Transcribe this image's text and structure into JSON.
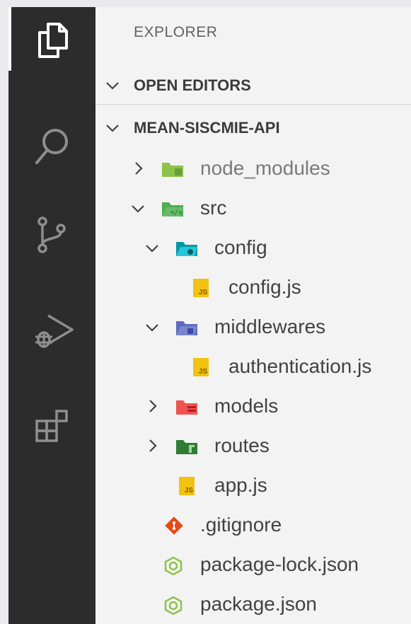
{
  "activity_bar": {
    "items": [
      {
        "icon": "files-icon",
        "active": true
      },
      {
        "icon": "search-icon",
        "active": false
      },
      {
        "icon": "source-control-icon",
        "active": false
      },
      {
        "icon": "run-debug-icon",
        "active": false
      },
      {
        "icon": "extensions-icon",
        "active": false
      }
    ]
  },
  "explorer": {
    "title": "EXPLORER",
    "open_editors_label": "OPEN EDITORS",
    "project_label": "MEAN-SISCMIE-API",
    "js_badge": "JS",
    "tree": [
      {
        "name": "node_modules",
        "type": "folder",
        "state": "collapsed",
        "icon": "node-folder-icon",
        "color": "#8bc34a"
      },
      {
        "name": "src",
        "type": "folder",
        "state": "expanded",
        "icon": "src-folder-icon",
        "color": "#4caf50"
      },
      {
        "name": "config",
        "type": "folder",
        "state": "expanded",
        "icon": "config-folder-icon",
        "color": "#26a6c5"
      },
      {
        "name": "config.js",
        "type": "file",
        "icon": "js-file-icon",
        "color": "#f3c10f"
      },
      {
        "name": "middlewares",
        "type": "folder",
        "state": "expanded",
        "icon": "middlewares-folder-icon",
        "color": "#7986cb"
      },
      {
        "name": "authentication.js",
        "type": "file",
        "icon": "js-file-icon",
        "color": "#f3c10f"
      },
      {
        "name": "models",
        "type": "folder",
        "state": "collapsed",
        "icon": "models-folder-icon",
        "color": "#ef5350"
      },
      {
        "name": "routes",
        "type": "folder",
        "state": "collapsed",
        "icon": "routes-folder-icon",
        "color": "#43a047"
      },
      {
        "name": "app.js",
        "type": "file",
        "icon": "js-file-icon",
        "color": "#f3c10f"
      },
      {
        "name": ".gitignore",
        "type": "file",
        "icon": "git-icon",
        "color": "#e64a19"
      },
      {
        "name": "package-lock.json",
        "type": "file",
        "icon": "nodejs-icon",
        "color": "#8bc34a"
      },
      {
        "name": "package.json",
        "type": "file",
        "icon": "nodejs-icon",
        "color": "#8bc34a"
      }
    ]
  }
}
